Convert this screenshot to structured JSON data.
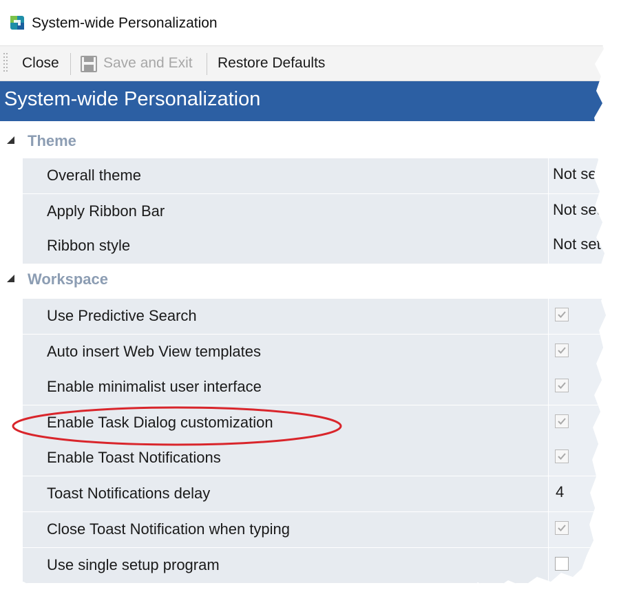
{
  "window": {
    "title": "System-wide Personalization",
    "icon": "app-icon"
  },
  "toolbar": {
    "close_label": "Close",
    "save_label": "Save and Exit",
    "restore_label": "Restore Defaults"
  },
  "header": {
    "title": "System-wide Personalization"
  },
  "groups": [
    {
      "label": "Theme",
      "expanded": true,
      "items": [
        {
          "label": "Overall theme",
          "value": "Not set"
        },
        {
          "label": "Apply Ribbon Bar",
          "value": "Not set"
        },
        {
          "label": "Ribbon style",
          "value": "Not set"
        }
      ]
    },
    {
      "label": "Workspace",
      "expanded": true,
      "items": [
        {
          "label": "Use Predictive Search",
          "checked": true
        },
        {
          "label": "Auto insert Web View templates",
          "checked": true
        },
        {
          "label": "Enable minimalist user interface",
          "checked": true
        },
        {
          "label": "Enable Task Dialog customization",
          "checked": true,
          "highlighted": true
        },
        {
          "label": "Enable Toast Notifications",
          "checked": true
        },
        {
          "label": "Toast Notifications delay",
          "value": "4"
        },
        {
          "label": "Close Toast Notification when typing",
          "checked": true
        },
        {
          "label": "Use single setup program",
          "checked": false
        }
      ]
    }
  ],
  "colors": {
    "header_band": "#2c5fa3",
    "group_label": "#8c9db3",
    "row_background": "#e7ebf0",
    "highlight_ellipse": "#d9252b"
  }
}
